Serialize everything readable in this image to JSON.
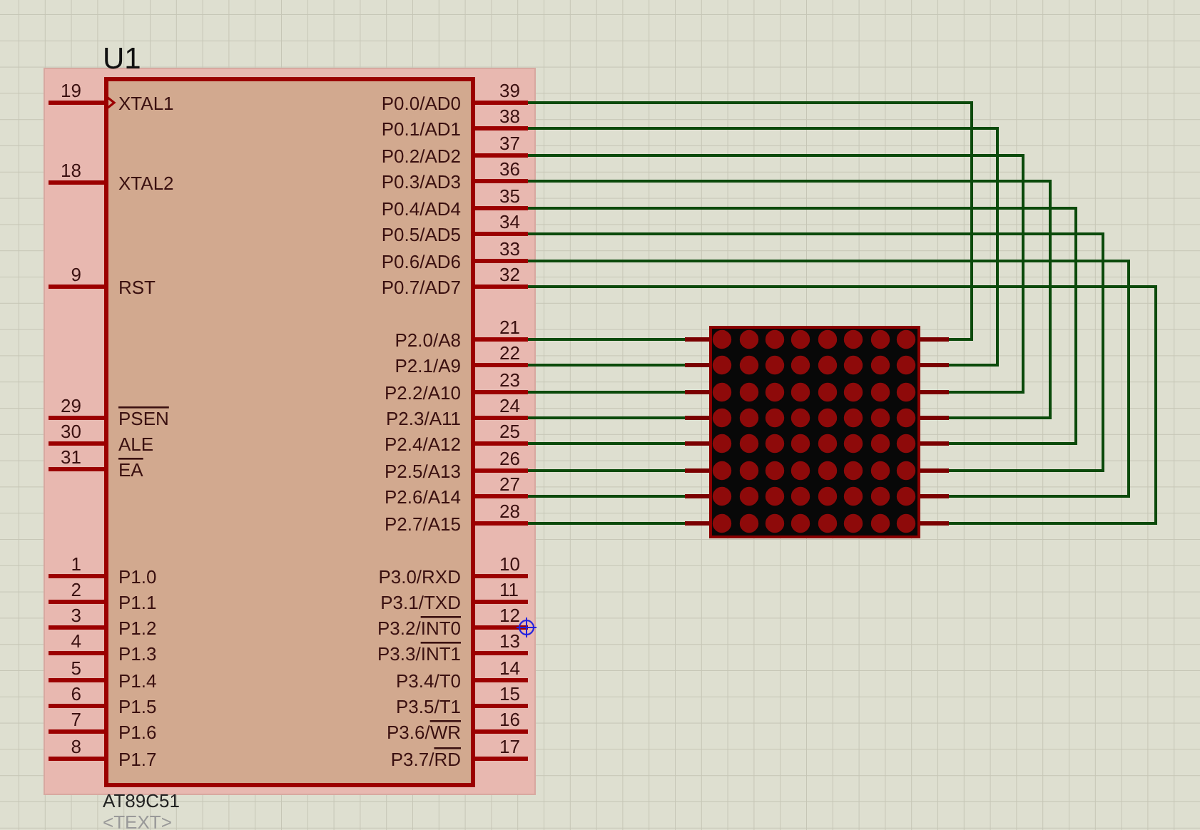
{
  "component": {
    "reference": "U1",
    "part": "AT89C51",
    "text_field": "<TEXT>",
    "selected": true,
    "left_pins": [
      {
        "number": "19",
        "label": "XTAL1",
        "kind": "clock"
      },
      {
        "number": "18",
        "label": "XTAL2",
        "kind": "plain"
      },
      {
        "number": "9",
        "label": "RST",
        "kind": "plain"
      },
      {
        "number": "29",
        "inverted_label": "PSEN",
        "kind": "plain"
      },
      {
        "number": "30",
        "label": "ALE",
        "kind": "plain"
      },
      {
        "number": "31",
        "inverted_label": "EA",
        "kind": "plain"
      },
      {
        "number": "1",
        "label": "P1.0",
        "kind": "plain"
      },
      {
        "number": "2",
        "label": "P1.1",
        "kind": "plain"
      },
      {
        "number": "3",
        "label": "P1.2",
        "kind": "plain"
      },
      {
        "number": "4",
        "label": "P1.3",
        "kind": "plain"
      },
      {
        "number": "5",
        "label": "P1.4",
        "kind": "plain"
      },
      {
        "number": "6",
        "label": "P1.5",
        "kind": "plain"
      },
      {
        "number": "7",
        "label": "P1.6",
        "kind": "plain"
      },
      {
        "number": "8",
        "label": "P1.7",
        "kind": "plain"
      }
    ],
    "right_pins": [
      {
        "number": "39",
        "label": "P0.0/AD0"
      },
      {
        "number": "38",
        "label": "P0.1/AD1"
      },
      {
        "number": "37",
        "label": "P0.2/AD2"
      },
      {
        "number": "36",
        "label": "P0.3/AD3"
      },
      {
        "number": "35",
        "label": "P0.4/AD4"
      },
      {
        "number": "34",
        "label": "P0.5/AD5"
      },
      {
        "number": "33",
        "label": "P0.6/AD6"
      },
      {
        "number": "32",
        "label": "P0.7/AD7"
      },
      {
        "number": "21",
        "label": "P2.0/A8"
      },
      {
        "number": "22",
        "label": "P2.1/A9"
      },
      {
        "number": "23",
        "label": "P2.2/A10"
      },
      {
        "number": "24",
        "label": "P2.3/A11"
      },
      {
        "number": "25",
        "label": "P2.4/A12"
      },
      {
        "number": "26",
        "label": "P2.5/A13"
      },
      {
        "number": "27",
        "label": "P2.6/A14"
      },
      {
        "number": "28",
        "label": "P2.7/A15"
      },
      {
        "number": "10",
        "label": "P3.0/RXD"
      },
      {
        "number": "11",
        "label": "P3.1/TXD"
      },
      {
        "number": "12",
        "label": "P3.2/",
        "inverted_label": "INT0"
      },
      {
        "number": "13",
        "label": "P3.3/",
        "inverted_label": "INT1"
      },
      {
        "number": "14",
        "label": "P3.4/T0"
      },
      {
        "number": "15",
        "label": "P3.5/T1"
      },
      {
        "number": "16",
        "label": "P3.6/",
        "inverted_label": "WR"
      },
      {
        "number": "17",
        "label": "P3.7/",
        "inverted_label": "RD"
      }
    ]
  }
}
